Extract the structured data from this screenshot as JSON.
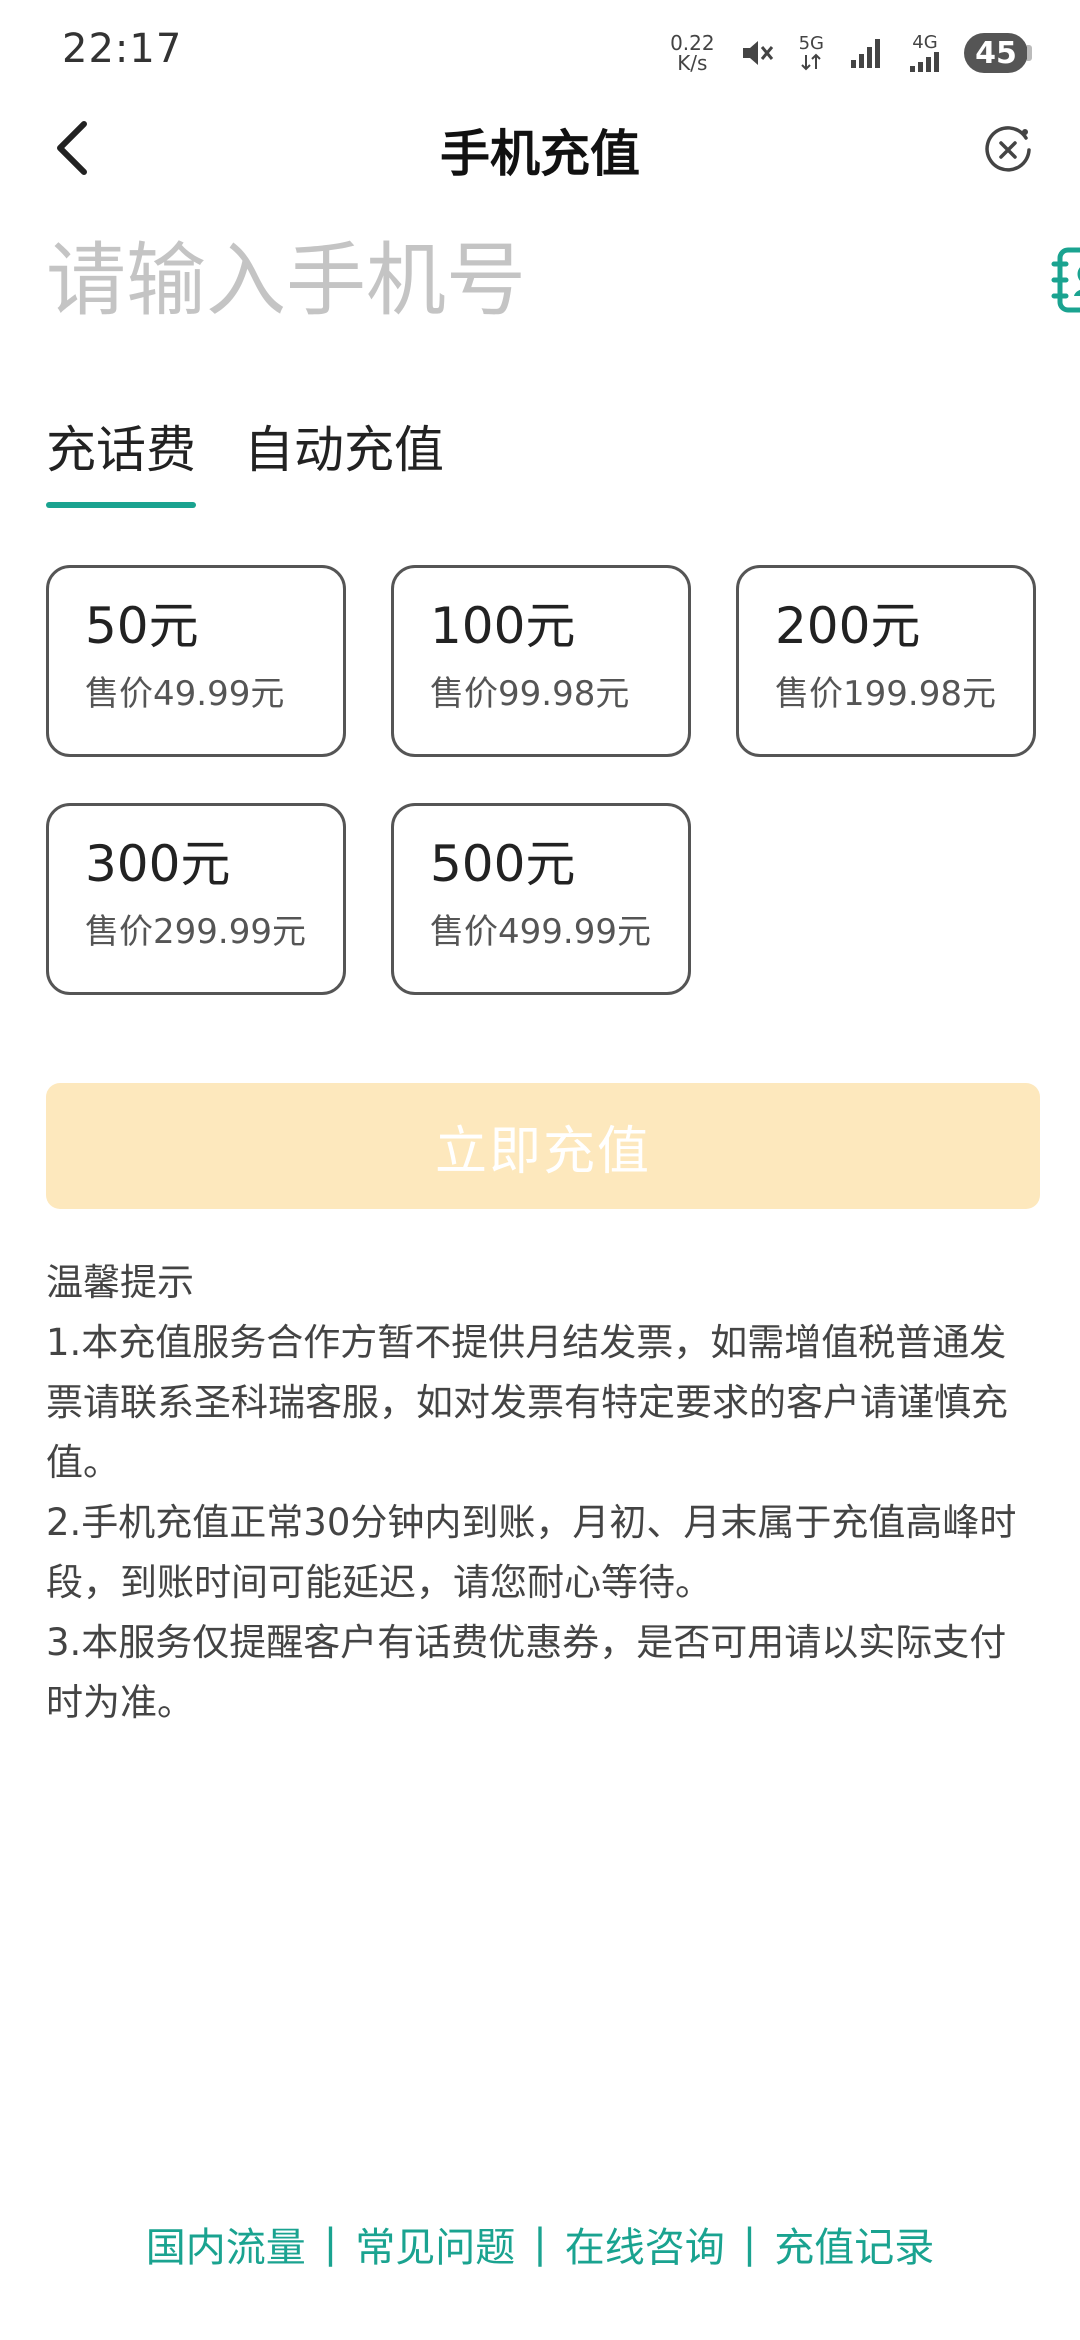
{
  "status_bar": {
    "time": "22:17",
    "speed_value": "0.22",
    "speed_unit": "K/s",
    "network_5g": "5G",
    "network_4g": "4G",
    "battery": "45",
    "icons": [
      "mute-icon",
      "signal-icon",
      "battery-icon"
    ]
  },
  "header": {
    "title": "手机充值",
    "back_icon": "chevron-left-icon",
    "close_icon": "close-circle-icon"
  },
  "phone": {
    "placeholder": "请输入手机号",
    "value": "",
    "contacts_icon": "contacts-book-icon"
  },
  "tabs": [
    {
      "label": "充话费",
      "active": true
    },
    {
      "label": "自动充值",
      "active": false
    }
  ],
  "amounts": [
    {
      "amount": "50元",
      "price": "售价49.99元"
    },
    {
      "amount": "100元",
      "price": "售价99.98元"
    },
    {
      "amount": "200元",
      "price": "售价199.98元"
    },
    {
      "amount": "300元",
      "price": "售价299.99元"
    },
    {
      "amount": "500元",
      "price": "售价499.99元"
    }
  ],
  "recharge_button": "立即充值",
  "tips": {
    "title": "温馨提示",
    "items": [
      "1.本充值服务合作方暂不提供月结发票，如需增值税普通发票请联系圣科瑞客服，如对发票有特定要求的客户请谨慎充值。",
      "2.手机充值正常30分钟内到账，月初、月末属于充值高峰时段，到账时间可能延迟，请您耐心等待。",
      "3.本服务仅提醒客户有话费优惠券，是否可用请以实际支付时为准。"
    ]
  },
  "footer": {
    "links": [
      "国内流量",
      "常见问题",
      "在线咨询",
      "充值记录"
    ],
    "separator": "|"
  },
  "colors": {
    "accent": "#1aa390",
    "button_disabled": "#fde8bd",
    "card_border": "#555555"
  }
}
